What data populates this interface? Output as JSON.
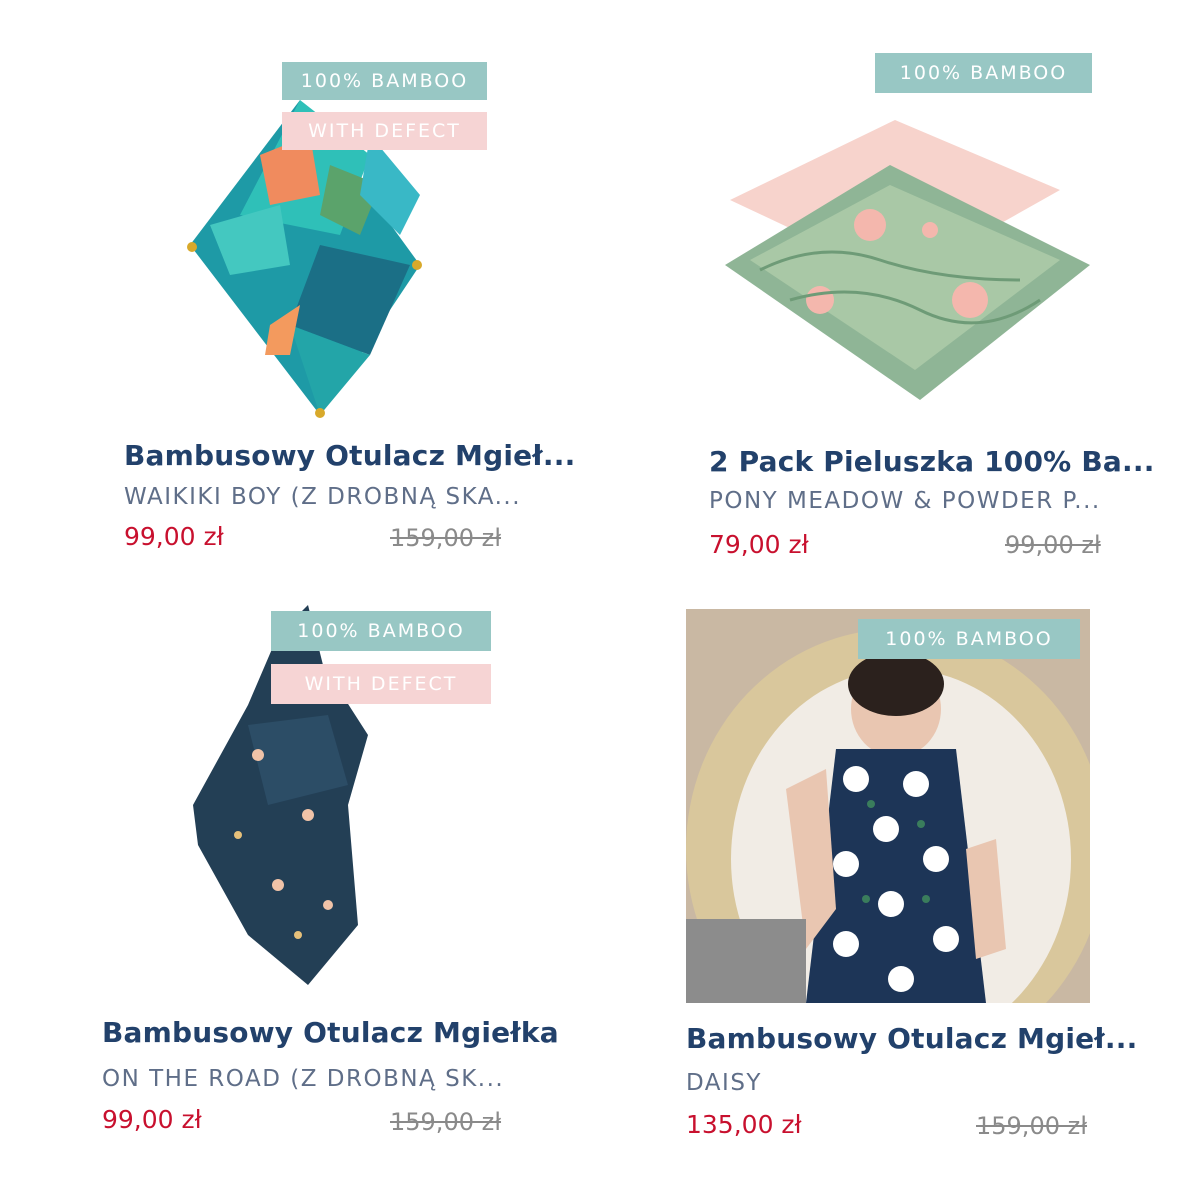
{
  "products": [
    {
      "badges": [
        "100% BAMBOO",
        "WITH DEFECT"
      ],
      "title": "Bambusowy Otulacz Mgieł...",
      "subtitle": "WAIKIKI BOY (Z DROBNĄ SKA...",
      "price": "99,00 zł",
      "old_price": "159,00 zł"
    },
    {
      "badges": [
        "100% BAMBOO"
      ],
      "title": "2 Pack Pieluszka 100% Ba...",
      "subtitle": "PONY MEADOW & POWDER P...",
      "price": "79,00 zł",
      "old_price": "99,00 zł"
    },
    {
      "badges": [
        "100% BAMBOO",
        "WITH DEFECT"
      ],
      "title": "Bambusowy Otulacz Mgiełka",
      "subtitle": "ON THE ROAD (Z DROBNĄ SK...",
      "price": "99,00 zł",
      "old_price": "159,00 zł"
    },
    {
      "badges": [
        "100% BAMBOO"
      ],
      "title": "Bambusowy Otulacz Mgieł...",
      "subtitle": "DAISY",
      "price": "135,00 zł",
      "old_price": "159,00 zł"
    }
  ],
  "colors": {
    "title": "#22416b",
    "price": "#c8102e",
    "badge_bamboo": "#98c7c4",
    "badge_defect": "#f6d4d4"
  }
}
